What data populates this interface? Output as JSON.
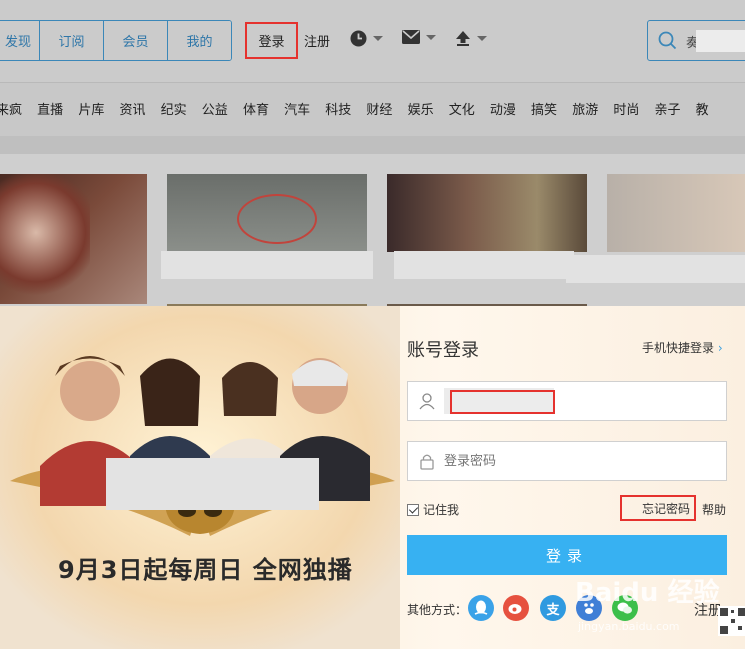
{
  "header": {
    "nav_tabs": [
      "发现",
      "订阅",
      "会员",
      "我的"
    ],
    "login_label": "登录",
    "register_label": "注册",
    "icons": [
      "clock-icon",
      "mail-icon",
      "upload-icon"
    ],
    "search_text": "奏"
  },
  "categories": [
    "来疯",
    "直播",
    "片库",
    "资讯",
    "纪实",
    "公益",
    "体育",
    "汽车",
    "科技",
    "财经",
    "娱乐",
    "文化",
    "动漫",
    "搞笑",
    "旅游",
    "时尚",
    "亲子",
    "教"
  ],
  "modal": {
    "close_label": "×",
    "promo_text": "9月3日起每周日 全网独播",
    "title": "账号登录",
    "mobile_login": "手机快捷登录",
    "password_placeholder": "登录密码",
    "remember_label": "记住我",
    "forgot_label": "忘记密码",
    "help_label": "帮助",
    "submit_label": "登录",
    "other_methods_label": "其他方式：",
    "register_label": "注册",
    "social_icons": [
      "qq-icon",
      "weibo-icon",
      "alipay-icon",
      "baidu-icon",
      "wechat-icon"
    ]
  },
  "colors": {
    "accent": "#37b1f2",
    "highlight": "#e5322e",
    "nav_border": "#3b87b8"
  },
  "watermark": {
    "brand": "Baidu 经验",
    "sub": "jingyan.baidu.com"
  }
}
